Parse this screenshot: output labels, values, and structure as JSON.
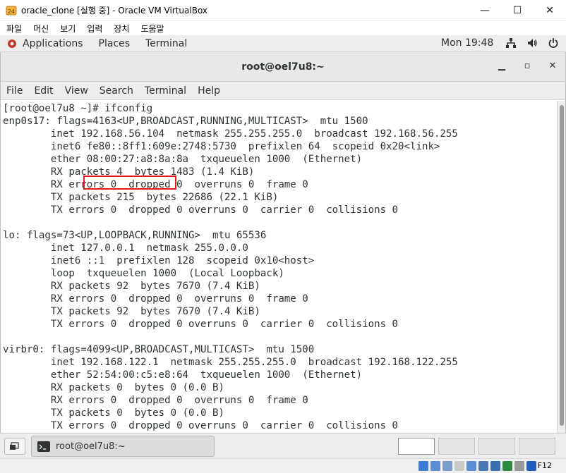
{
  "vbox_window": {
    "title": "oracle_clone [실행 중] - Oracle VM VirtualBox",
    "menu": [
      "파일",
      "머신",
      "보기",
      "입력",
      "장치",
      "도움말"
    ],
    "controls": {
      "minimize": "—",
      "maximize": "☐",
      "close": "✕"
    },
    "status_host_key": "F12"
  },
  "gnome_top_bar": {
    "applications": "Applications",
    "places": "Places",
    "terminal": "Terminal",
    "clock": "Mon 19:48"
  },
  "terminal": {
    "title": "root@oel7u8:~",
    "controls": {
      "minimize": "▁",
      "maximize": "▫",
      "close": "✕"
    },
    "menu": [
      "File",
      "Edit",
      "View",
      "Search",
      "Terminal",
      "Help"
    ],
    "highlighted_value": "192.168.56.104",
    "lines": [
      "[root@oel7u8 ~]# ifconfig",
      "enp0s17: flags=4163<UP,BROADCAST,RUNNING,MULTICAST>  mtu 1500",
      "        inet 192.168.56.104  netmask 255.255.255.0  broadcast 192.168.56.255",
      "        inet6 fe80::8ff1:609e:2748:5730  prefixlen 64  scopeid 0x20<link>",
      "        ether 08:00:27:a8:8a:8a  txqueuelen 1000  (Ethernet)",
      "        RX packets 4  bytes 1483 (1.4 KiB)",
      "        RX errors 0  dropped 0  overruns 0  frame 0",
      "        TX packets 215  bytes 22686 (22.1 KiB)",
      "        TX errors 0  dropped 0 overruns 0  carrier 0  collisions 0",
      "",
      "lo: flags=73<UP,LOOPBACK,RUNNING>  mtu 65536",
      "        inet 127.0.0.1  netmask 255.0.0.0",
      "        inet6 ::1  prefixlen 128  scopeid 0x10<host>",
      "        loop  txqueuelen 1000  (Local Loopback)",
      "        RX packets 92  bytes 7670 (7.4 KiB)",
      "        RX errors 0  dropped 0  overruns 0  frame 0",
      "        TX packets 92  bytes 7670 (7.4 KiB)",
      "        TX errors 0  dropped 0 overruns 0  carrier 0  collisions 0",
      "",
      "virbr0: flags=4099<UP,BROADCAST,MULTICAST>  mtu 1500",
      "        inet 192.168.122.1  netmask 255.255.255.0  broadcast 192.168.122.255",
      "        ether 52:54:00:c5:e8:64  txqueuelen 1000  (Ethernet)",
      "        RX packets 0  bytes 0 (0.0 B)",
      "        RX errors 0  dropped 0  overruns 0  frame 0",
      "        TX packets 0  bytes 0 (0.0 B)",
      "        TX errors 0  dropped 0 overruns 0  carrier 0  collisions 0"
    ]
  },
  "bottom_panel": {
    "task_label": "root@oel7u8:~"
  },
  "colors": {
    "highlight_box": "#e0181b",
    "terminal_text": "#2e3436",
    "terminal_bg": "#ffffff"
  }
}
